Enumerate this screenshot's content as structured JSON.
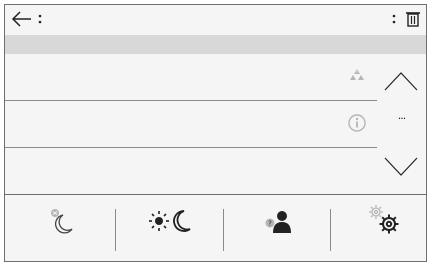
{
  "header": {
    "back_icon": "arrow-left-icon",
    "left_menu_icon": "more-vertical-icon",
    "right_menu_icon": "more-vertical-icon",
    "delete_icon": "trash-icon"
  },
  "rows": [
    {
      "icon": "warning-triangles-icon"
    },
    {
      "icon": "info-icon"
    },
    {
      "icon": ""
    }
  ],
  "scroll": {
    "up_icon": "chevron-up-icon",
    "indicator": "...",
    "down_icon": "chevron-down-icon"
  },
  "bottom_tabs": [
    {
      "icon": "night-mode-icon"
    },
    {
      "icon": "day-night-icon"
    },
    {
      "icon": "profile-help-icon"
    },
    {
      "icon": "settings-gears-icon"
    }
  ],
  "colors": {
    "background": "#f5f5f5",
    "subbar": "#d8d8d8",
    "separator": "#8a8a8a",
    "icon_dark": "#222222",
    "icon_muted": "#b5b5b5"
  }
}
